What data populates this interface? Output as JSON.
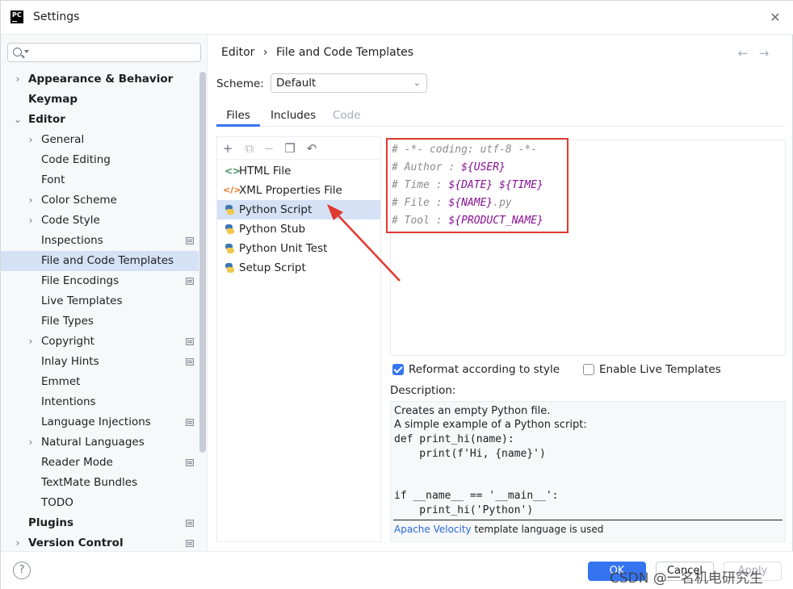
{
  "window": {
    "title": "Settings",
    "app_logo": "PC"
  },
  "sidebar": {
    "search_placeholder": "",
    "items": [
      {
        "label": "Appearance & Behavior",
        "level": 0,
        "expandable": true,
        "expanded": false,
        "bold": true
      },
      {
        "label": "Keymap",
        "level": 0,
        "expandable": false,
        "bold": true
      },
      {
        "label": "Editor",
        "level": 0,
        "expandable": true,
        "expanded": true,
        "bold": true
      },
      {
        "label": "General",
        "level": 1,
        "expandable": true,
        "expanded": false
      },
      {
        "label": "Code Editing",
        "level": 1,
        "expandable": false
      },
      {
        "label": "Font",
        "level": 1,
        "expandable": false
      },
      {
        "label": "Color Scheme",
        "level": 1,
        "expandable": true,
        "expanded": false
      },
      {
        "label": "Code Style",
        "level": 1,
        "expandable": true,
        "expanded": false
      },
      {
        "label": "Inspections",
        "level": 1,
        "expandable": false,
        "page_icon": true
      },
      {
        "label": "File and Code Templates",
        "level": 1,
        "expandable": false,
        "selected": true
      },
      {
        "label": "File Encodings",
        "level": 1,
        "expandable": false,
        "page_icon": true
      },
      {
        "label": "Live Templates",
        "level": 1,
        "expandable": false
      },
      {
        "label": "File Types",
        "level": 1,
        "expandable": false
      },
      {
        "label": "Copyright",
        "level": 1,
        "expandable": true,
        "expanded": false,
        "page_icon": true
      },
      {
        "label": "Inlay Hints",
        "level": 1,
        "expandable": false,
        "page_icon": true
      },
      {
        "label": "Emmet",
        "level": 1,
        "expandable": false
      },
      {
        "label": "Intentions",
        "level": 1,
        "expandable": false
      },
      {
        "label": "Language Injections",
        "level": 1,
        "expandable": false,
        "page_icon": true
      },
      {
        "label": "Natural Languages",
        "level": 1,
        "expandable": true,
        "expanded": false
      },
      {
        "label": "Reader Mode",
        "level": 1,
        "expandable": false,
        "page_icon": true
      },
      {
        "label": "TextMate Bundles",
        "level": 1,
        "expandable": false
      },
      {
        "label": "TODO",
        "level": 1,
        "expandable": false
      },
      {
        "label": "Plugins",
        "level": 0,
        "expandable": false,
        "bold": true,
        "page_icon": true
      },
      {
        "label": "Version Control",
        "level": 0,
        "expandable": true,
        "expanded": false,
        "bold": true,
        "page_icon": true
      }
    ]
  },
  "breadcrumb": {
    "parent": "Editor",
    "separator": "›",
    "current": "File and Code Templates"
  },
  "scheme": {
    "label": "Scheme:",
    "value": "Default"
  },
  "tabs": [
    {
      "label": "Files",
      "active": true
    },
    {
      "label": "Includes",
      "active": false
    },
    {
      "label": "Code",
      "disabled": true
    }
  ],
  "templates": [
    {
      "label": "HTML File",
      "icon": "html-icon"
    },
    {
      "label": "XML Properties File",
      "icon": "xml-icon"
    },
    {
      "label": "Python Script",
      "icon": "python-icon",
      "selected": true
    },
    {
      "label": "Python Stub",
      "icon": "python-icon"
    },
    {
      "label": "Python Unit Test",
      "icon": "python-icon"
    },
    {
      "label": "Setup Script",
      "icon": "python-icon"
    }
  ],
  "editor": {
    "lines": [
      {
        "prefix": "# -*- coding: utf-8 -*-",
        "var": "",
        "suffix": ""
      },
      {
        "prefix": "# Author : ",
        "var": "${USER}",
        "suffix": ""
      },
      {
        "prefix": "# Time : ",
        "var": "${DATE} ${TIME}",
        "suffix": ""
      },
      {
        "prefix": "# File : ",
        "var": "${NAME}",
        "suffix": ".py"
      },
      {
        "prefix": "# Tool : ",
        "var": "${PRODUCT_NAME}",
        "suffix": ""
      }
    ]
  },
  "options": {
    "reformat": {
      "label": "Reformat according to style",
      "checked": true
    },
    "live_templates": {
      "label": "Enable Live Templates",
      "checked": false
    }
  },
  "description": {
    "label": "Description:",
    "text_lines": [
      "Creates an empty Python file.",
      "A simple example of a Python script:"
    ],
    "code_lines": [
      "def print_hi(name):",
      "    print(f'Hi, {name}')",
      "",
      "",
      "if __name__ == '__main__':",
      "    print_hi('Python')"
    ],
    "footer_link": "Apache Velocity",
    "footer_text": " template language is used"
  },
  "footer": {
    "help": "?",
    "ok": "OK",
    "cancel": "Cancel",
    "apply": "Apply",
    "watermark": "CSDN @一名机电研究生"
  },
  "colors": {
    "accent": "#3574f0",
    "selection": "#d5e1f5",
    "annotation": "#e0392f"
  }
}
